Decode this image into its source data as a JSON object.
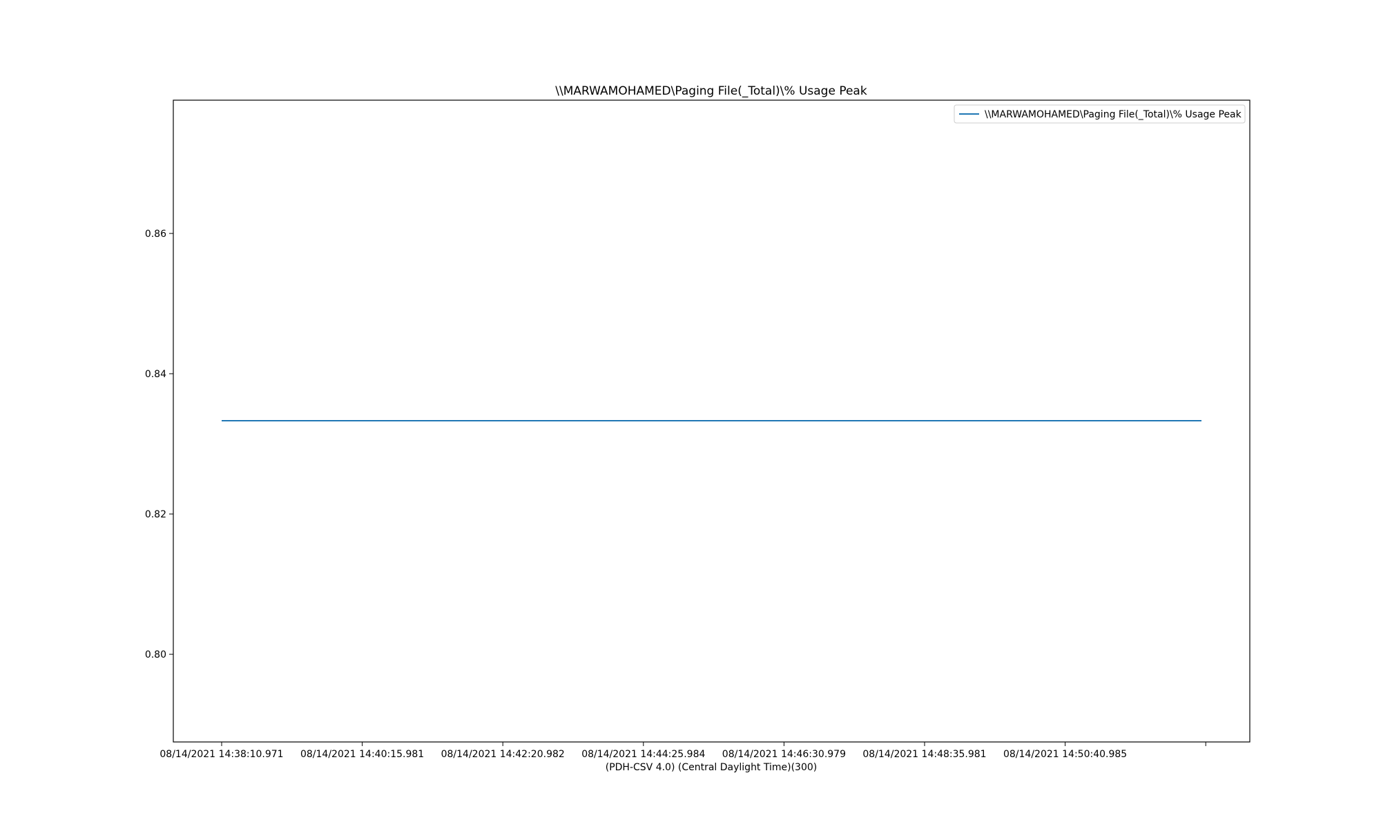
{
  "chart_data": {
    "type": "line",
    "title": "\\\\MARWAMOHAMED\\Paging File(_Total)\\% Usage Peak",
    "xlabel": "(PDH-CSV 4.0) (Central Daylight Time)(300)",
    "ylabel": "",
    "x_ticks": [
      "08/14/2021 14:38:10.971",
      "08/14/2021 14:40:15.981",
      "08/14/2021 14:42:20.982",
      "08/14/2021 14:44:25.984",
      "08/14/2021 14:46:30.979",
      "08/14/2021 14:48:35.981",
      "08/14/2021 14:50:40.985",
      ""
    ],
    "y_ticks": [
      0.8,
      0.82,
      0.84,
      0.86
    ],
    "ylim": [
      0.7875,
      0.879
    ],
    "grid": false,
    "legend_position": "top-right",
    "series": [
      {
        "name": "\\\\MARWAMOHAMED\\Paging File(_Total)\\% Usage Peak",
        "color": "#1f77b4",
        "x": [
          "08/14/2021 14:38:10.971",
          "08/14/2021 14:40:15.981",
          "08/14/2021 14:42:20.982",
          "08/14/2021 14:44:25.984",
          "08/14/2021 14:46:30.979",
          "08/14/2021 14:48:35.981",
          "08/14/2021 14:50:40.985",
          "08/14/2021 14:52:40"
        ],
        "values": [
          0.8333,
          0.8333,
          0.8333,
          0.8333,
          0.8333,
          0.8333,
          0.8333,
          0.8333
        ]
      }
    ]
  }
}
